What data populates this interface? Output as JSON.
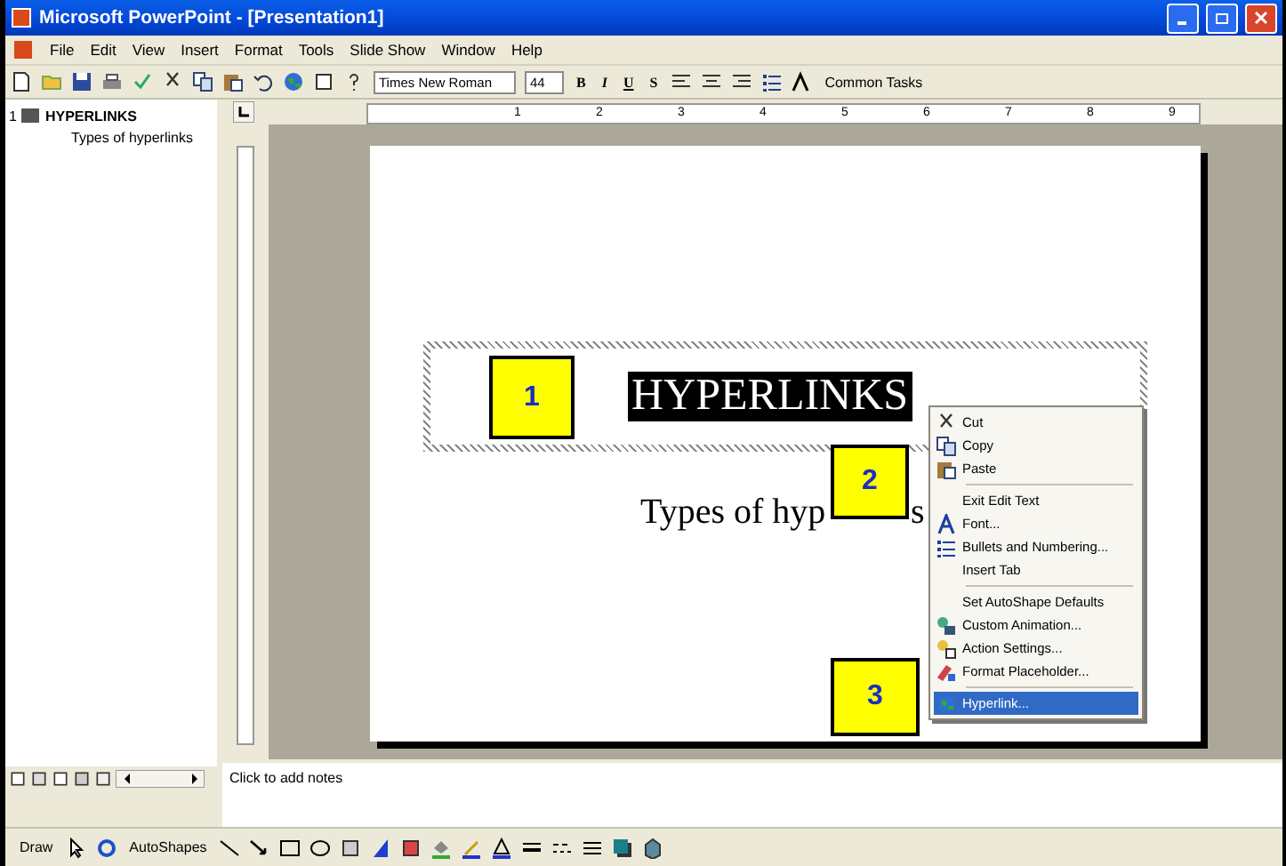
{
  "window": {
    "title": "Microsoft PowerPoint - [Presentation1]"
  },
  "menu": [
    "File",
    "Edit",
    "View",
    "Insert",
    "Format",
    "Tools",
    "Slide Show",
    "Window",
    "Help"
  ],
  "formatting": {
    "font": "Times New Roman",
    "size": "44",
    "styles": [
      "B",
      "I",
      "U",
      "S"
    ],
    "common_tasks": "Common Tasks"
  },
  "ruler_numbers": [
    "1",
    "2",
    "3",
    "4",
    "5",
    "6",
    "7",
    "8",
    "9"
  ],
  "outline": [
    {
      "number": "1",
      "title": "HYPERLINKS",
      "children": [
        {
          "text": "Types of hyperlinks"
        }
      ]
    }
  ],
  "slide": {
    "title": "HYPERLINKS",
    "subtitle_start": "Types of hyp",
    "subtitle_end": "s"
  },
  "callouts": [
    "1",
    "2",
    "3"
  ],
  "context_menu": [
    {
      "kind": "item",
      "label": "Cut",
      "selected": false
    },
    {
      "kind": "item",
      "label": "Copy",
      "selected": false
    },
    {
      "kind": "item",
      "label": "Paste",
      "selected": false
    },
    {
      "kind": "separator"
    },
    {
      "kind": "item",
      "label": "Exit Edit Text",
      "selected": false
    },
    {
      "kind": "item",
      "label": "Font...",
      "selected": false
    },
    {
      "kind": "item",
      "label": "Bullets and Numbering...",
      "selected": false
    },
    {
      "kind": "item",
      "label": "Insert Tab",
      "selected": false
    },
    {
      "kind": "separator"
    },
    {
      "kind": "item",
      "label": "Set AutoShape Defaults",
      "selected": false
    },
    {
      "kind": "item",
      "label": "Custom Animation...",
      "selected": false
    },
    {
      "kind": "item",
      "label": "Action Settings...",
      "selected": false
    },
    {
      "kind": "item",
      "label": "Format Placeholder...",
      "selected": false
    },
    {
      "kind": "separator"
    },
    {
      "kind": "item",
      "label": "Hyperlink...",
      "selected": true
    }
  ],
  "notes": {
    "placeholder": "Click to add notes"
  },
  "drawing_toolbar": {
    "draw": "Draw",
    "autoshapes": "AutoShapes"
  }
}
